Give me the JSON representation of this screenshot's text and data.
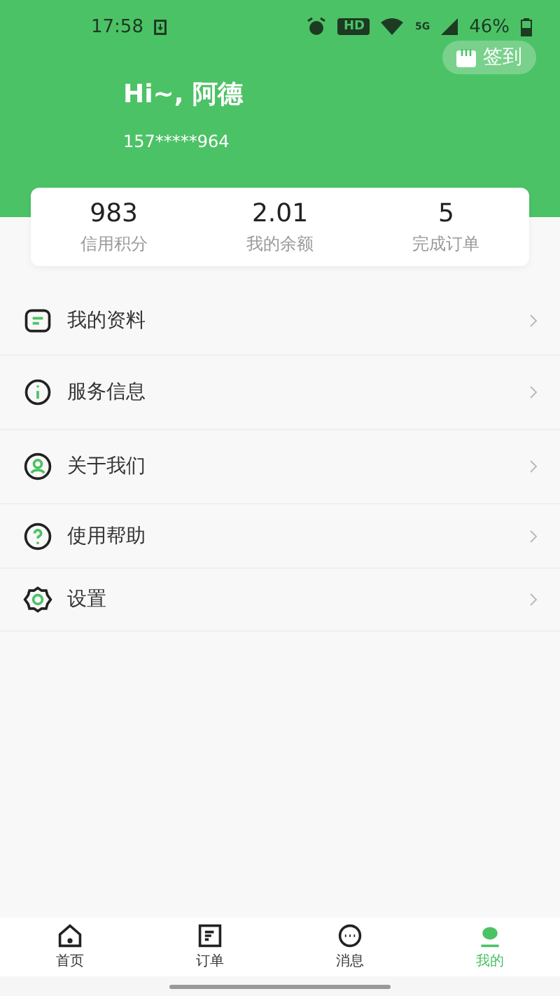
{
  "status_bar": {
    "time": "17:58",
    "hd": "HD",
    "network": "5G",
    "battery": "46%"
  },
  "header": {
    "greeting": "Hi~, 阿德",
    "phone": "157*****964",
    "checkin": "签到"
  },
  "stats": [
    {
      "value": "983",
      "label": "信用积分"
    },
    {
      "value": "2.01",
      "label": "我的余额"
    },
    {
      "value": "5",
      "label": "完成订单"
    }
  ],
  "menu": [
    {
      "kind": "profile",
      "label": "我的资料"
    },
    {
      "kind": "info",
      "label": "服务信息"
    },
    {
      "kind": "about",
      "label": "关于我们"
    },
    {
      "kind": "help",
      "label": "使用帮助"
    },
    {
      "kind": "settings",
      "label": "设置"
    }
  ],
  "tabs": [
    {
      "kind": "home",
      "label": "首页",
      "selected": false
    },
    {
      "kind": "orders",
      "label": "订单",
      "selected": false
    },
    {
      "kind": "messages",
      "label": "消息",
      "selected": false
    },
    {
      "kind": "me",
      "label": "我的",
      "selected": true
    }
  ]
}
